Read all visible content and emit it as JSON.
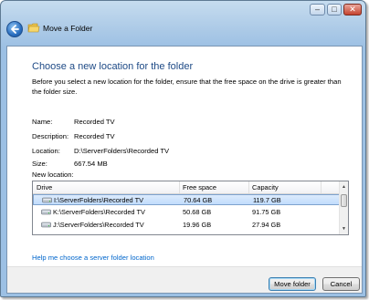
{
  "window": {
    "title": "Move a Folder",
    "controls": {
      "minimize": "–",
      "maximize": "□",
      "close": "✕"
    }
  },
  "content": {
    "heading": "Choose a new location for the folder",
    "intro": "Before you select a new location for the folder, ensure that the free space on the drive is greater than the folder size.",
    "fields": [
      {
        "label": "Name:",
        "value": "Recorded TV"
      },
      {
        "label": "Description:",
        "value": "Recorded TV"
      },
      {
        "label": "Location:",
        "value": "D:\\ServerFolders\\Recorded TV"
      },
      {
        "label": "Size:",
        "value": "667.54 MB"
      }
    ],
    "new_location_label": "New location:"
  },
  "list": {
    "columns": [
      "Drive",
      "Free space",
      "Capacity"
    ],
    "rows": [
      {
        "drive": "I:\\ServerFolders\\Recorded TV",
        "free": "70.64 GB",
        "capacity": "119.7 GB",
        "selected": true
      },
      {
        "drive": "K:\\ServerFolders\\Recorded TV",
        "free": "50.68 GB",
        "capacity": "91.75 GB",
        "selected": false
      },
      {
        "drive": "J:\\ServerFolders\\Recorded TV",
        "free": "19.96 GB",
        "capacity": "27.94 GB",
        "selected": false
      }
    ]
  },
  "help_link": "Help me choose a server folder location",
  "buttons": {
    "move": "Move folder",
    "cancel": "Cancel"
  },
  "icons": {
    "back": "back-arrow-icon",
    "folder": "folder-icon",
    "drive": "drive-icon"
  },
  "colors": {
    "heading": "#1e4a86",
    "link": "#0066cc",
    "selection": "#c1dcfc"
  }
}
